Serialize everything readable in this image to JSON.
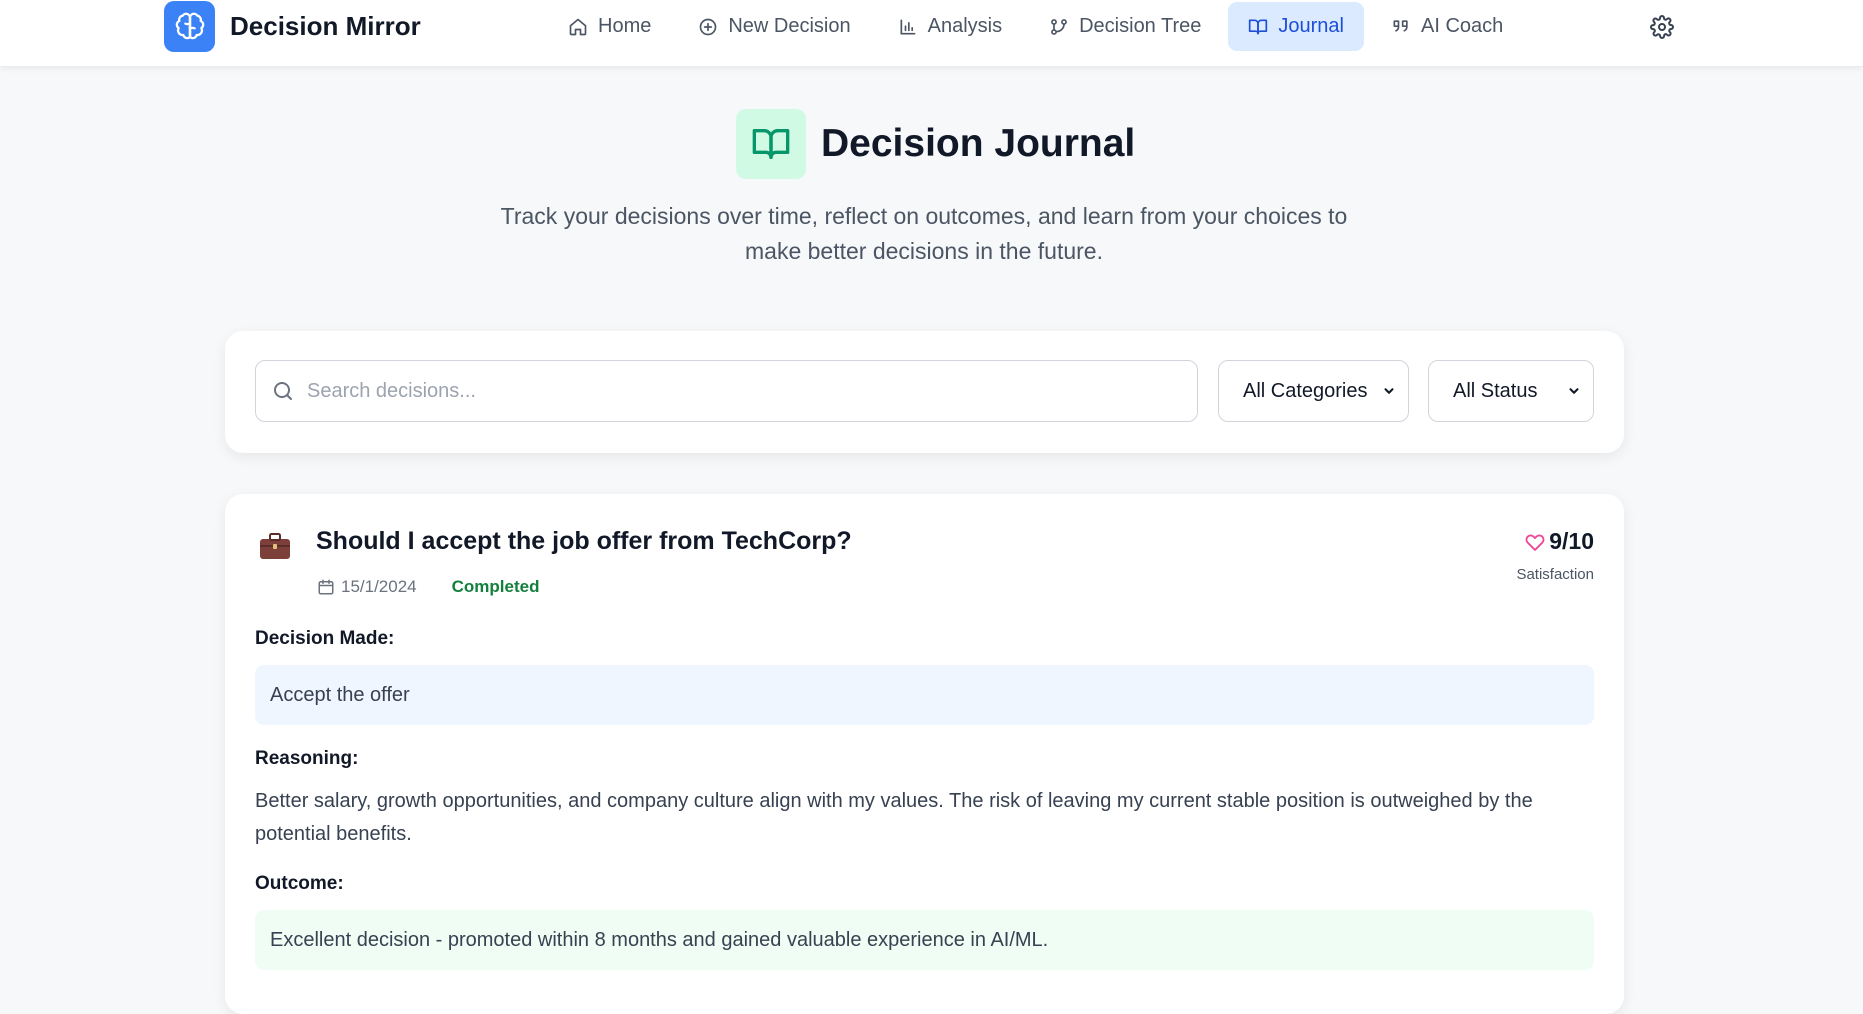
{
  "app": {
    "name": "Decision Mirror"
  },
  "nav": {
    "items": [
      {
        "label": "Home",
        "icon": "home-icon"
      },
      {
        "label": "New Decision",
        "icon": "plus-circle-icon"
      },
      {
        "label": "Analysis",
        "icon": "bar-chart-icon"
      },
      {
        "label": "Decision Tree",
        "icon": "branch-icon"
      },
      {
        "label": "Journal",
        "icon": "book-icon",
        "active": true
      },
      {
        "label": "AI Coach",
        "icon": "quote-icon"
      }
    ],
    "active": "Journal",
    "settings_icon": "gear-icon"
  },
  "hero": {
    "title": "Decision Journal",
    "subtitle": "Track your decisions over time, reflect on outcomes, and learn from your choices to make better decisions in the future."
  },
  "filters": {
    "search_placeholder": "Search decisions...",
    "category_selected": "All Categories",
    "status_selected": "All Status"
  },
  "entry": {
    "category_icon": "briefcase-icon",
    "title": "Should I accept the job offer from TechCorp?",
    "date": "15/1/2024",
    "status": "Completed",
    "score": "9/10",
    "score_label": "Satisfaction",
    "decision_label": "Decision Made:",
    "decision": "Accept the offer",
    "reasoning_label": "Reasoning:",
    "reasoning": "Better salary, growth opportunities, and company culture align with my values. The risk of leaving my current stable position is outweighed by the potential benefits.",
    "outcome_label": "Outcome:",
    "outcome": "Excellent decision - promoted within 8 months and gained valuable experience in AI/ML."
  },
  "colors": {
    "brand": "#3b82f6",
    "active_nav_bg": "#dbeafe",
    "active_nav_text": "#1d4ed8",
    "status_completed": "#15803d",
    "heart": "#ec4899",
    "journal_icon_bg": "#d1fae5",
    "journal_icon": "#059669"
  }
}
